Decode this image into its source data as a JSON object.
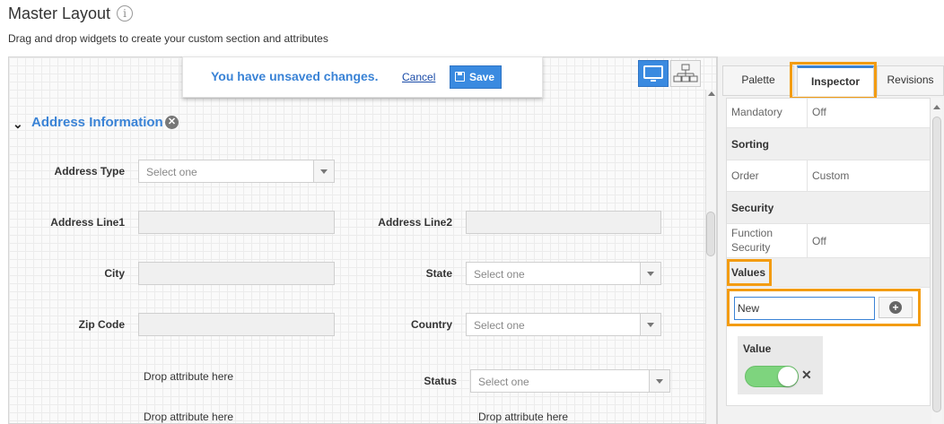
{
  "header": {
    "title": "Master Layout",
    "info_glyph": "i",
    "subtitle": "Drag and drop widgets to create your custom section and attributes"
  },
  "unsaved_bar": {
    "message": "You have unsaved changes.",
    "cancel_label": "Cancel",
    "save_label": "Save"
  },
  "view_toggle": {
    "icons": [
      "desktop-icon",
      "hierarchy-icon"
    ],
    "selected": "desktop"
  },
  "section": {
    "title": "Address Information",
    "collapse_glyph": "⌄",
    "remove_glyph": "✕"
  },
  "form": {
    "fields": [
      {
        "label": "Address Type",
        "type": "select",
        "placeholder": "Select one"
      },
      {
        "label": "Address Line1",
        "type": "text"
      },
      {
        "label": "Address Line2",
        "type": "text"
      },
      {
        "label": "City",
        "type": "text"
      },
      {
        "label": "State",
        "type": "select",
        "placeholder": "Select one"
      },
      {
        "label": "Zip Code",
        "type": "text"
      },
      {
        "label": "Country",
        "type": "select",
        "placeholder": "Select one"
      },
      {
        "label": "Status",
        "type": "select",
        "placeholder": "Select one"
      }
    ],
    "drop_placeholders": [
      "Drop attribute here",
      "Drop attribute here",
      "Drop attribute here"
    ]
  },
  "right_panel": {
    "tabs": [
      {
        "label": "Palette",
        "active": false
      },
      {
        "label": "Inspector",
        "active": true
      },
      {
        "label": "Revisions",
        "active": false
      }
    ],
    "properties": {
      "mandatory": {
        "key": "Mandatory",
        "value": "Off"
      },
      "sorting_header": "Sorting",
      "order": {
        "key": "Order",
        "value": "Custom"
      },
      "security_header": "Security",
      "function_security": {
        "key_line1": "Function",
        "key_line2": "Security",
        "value": "Off"
      },
      "values_header": "Values"
    },
    "values_input": {
      "value": "New"
    },
    "add_glyph": "+",
    "value_card": {
      "label": "Value",
      "toggle_on": true,
      "remove_glyph": "✕"
    }
  },
  "colors": {
    "accent": "#3a83d6",
    "highlight": "#f39c12",
    "toggle_on": "#7ed47e"
  }
}
